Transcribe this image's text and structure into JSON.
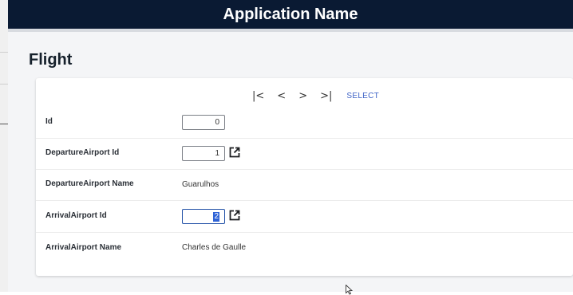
{
  "header": {
    "title": "Application Name"
  },
  "page": {
    "title": "Flight"
  },
  "nav": {
    "first": "|<",
    "prev": "<",
    "next": ">",
    "last": ">|",
    "select_label": "SELECT"
  },
  "form": {
    "id": {
      "label": "Id",
      "value": "0"
    },
    "departure_id": {
      "label": "DepartureAirport Id",
      "value": "1"
    },
    "departure_name": {
      "label": "DepartureAirport Name",
      "value": "Guarulhos"
    },
    "arrival_id": {
      "label": "ArrivalAirport Id",
      "value": "2"
    },
    "arrival_name": {
      "label": "ArrivalAirport Name",
      "value": "Charles de Gaulle"
    }
  },
  "colors": {
    "header_bg": "#0a1a33",
    "accent": "#3e63c6",
    "selection": "#2f63d6"
  },
  "icons": [
    "first-page-icon",
    "prev-page-icon",
    "next-page-icon",
    "last-page-icon",
    "open-external-icon",
    "mouse-cursor-icon"
  ]
}
